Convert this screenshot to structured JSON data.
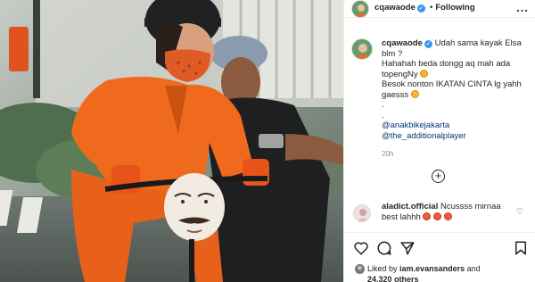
{
  "post": {
    "username": "cqawaode",
    "follow_status": "Following",
    "dot": "•",
    "more": "...",
    "verified_glyph": "✓"
  },
  "caption": {
    "username": "cqawaode",
    "lines": [
      "Udah sama kayak Elsa blm ?",
      "Hahahah beda dongg aq mah ada topengNy",
      "Besok nonton IKATAN CINTA lg yahh gaesss",
      "."
    ],
    "mentions": [
      "@anakbikejakarta",
      "@the_additionalplayer"
    ],
    "time": "20h"
  },
  "load_more": "+",
  "comment": {
    "username": "aladict.official",
    "text": "Ncussss mirnaa best lahhh",
    "like_icon": "heart-outline-icon"
  },
  "likes": {
    "prefix": "Liked by",
    "user": "iam.evansanders",
    "and": "and",
    "count": "24,320 others"
  },
  "icons": {
    "actions": [
      "heart-icon",
      "comment-icon",
      "share-icon",
      "bookmark-icon"
    ]
  },
  "colors": {
    "verified": "#3897f0",
    "mention": "#00376b",
    "jumpsuit": "#f06a1e",
    "muted": "#8e8e8e"
  }
}
